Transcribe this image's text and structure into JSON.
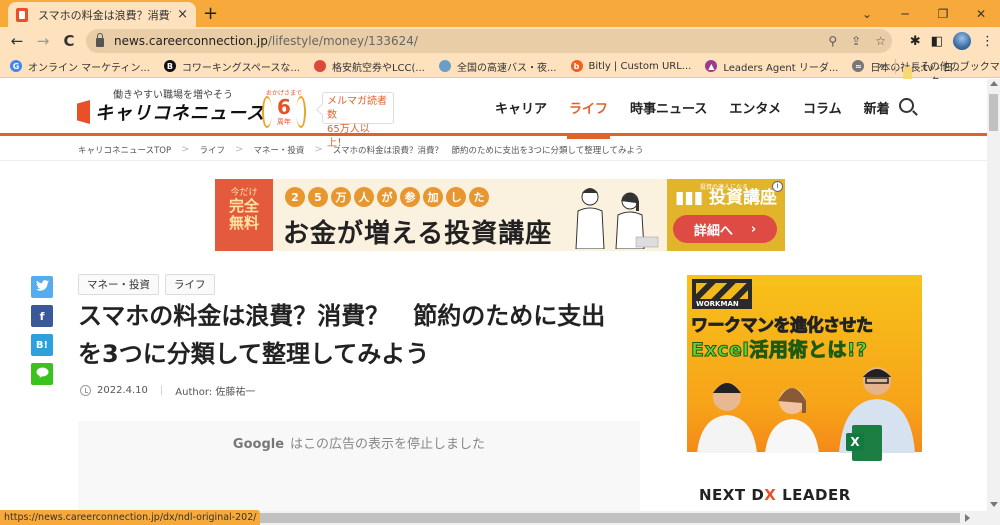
{
  "browser": {
    "tab_title": "スマホの料金は浪費？消費？ 節約",
    "tab_close": "×",
    "new_tab": "+",
    "window_controls": {
      "tab_search": "⌄",
      "minimize": "─",
      "restore": "❐",
      "close": "✕"
    },
    "nav": {
      "back": "←",
      "forward": "→",
      "reload": "C"
    },
    "url_host": "news.careerconnection.jp",
    "url_path": "/lifestyle/money/133624/",
    "omnibox_icons": [
      "search-icon",
      "share-icon",
      "star-icon"
    ],
    "toolbar_icons": [
      "extensions-icon",
      "side-panel-icon",
      "profile-avatar",
      "menu-icon"
    ],
    "bookmarks": [
      {
        "label": "オンライン マーケティン...",
        "icon": "google-icon",
        "icon_text": "G",
        "color": "#4285f4"
      },
      {
        "label": "コワーキングスペースな...",
        "icon": "b-icon",
        "icon_text": "B",
        "color": "#111111"
      },
      {
        "label": "格安航空券やLCC(...",
        "icon": "mascot-icon",
        "icon_text": "",
        "color": "#d94a3a"
      },
      {
        "label": "全国の高速バス・夜...",
        "icon": "globe-icon",
        "icon_text": "",
        "color": "#6a9ec8"
      },
      {
        "label": "Bitly | Custom URL...",
        "icon": "bitly-icon",
        "icon_text": "b",
        "color": "#ee6123"
      },
      {
        "label": "Leaders Agent リーダ...",
        "icon": "triangle-icon",
        "icon_text": "▲",
        "color": "#9b3a8e"
      },
      {
        "label": "日本の社長.tv - 日...",
        "icon": "tv-icon",
        "icon_text": "≈",
        "color": "#777777"
      }
    ],
    "bookmarks_more": "»",
    "other_bookmarks": "その他のブックマーク",
    "status_url": "https://news.careerconnection.jp/dx/ndl-original-202/"
  },
  "site": {
    "tagline": "働きやすい職場を増やそう",
    "logo": "キャリコネニュース",
    "anniversary": {
      "top": "おかげさまで",
      "number": "6",
      "unit": "周年"
    },
    "mail_badge": {
      "line1": "メルマガ読者数",
      "line2": "65万人以上！"
    },
    "nav": [
      {
        "label": "キャリア",
        "active": false
      },
      {
        "label": "ライフ",
        "active": true
      },
      {
        "label": "時事ニュース",
        "active": false
      },
      {
        "label": "エンタメ",
        "active": false
      },
      {
        "label": "コラム",
        "active": false
      },
      {
        "label": "新着",
        "active": false
      }
    ],
    "accent": "#e0622b"
  },
  "breadcrumb": [
    "キャリコネニュースTOP",
    "ライフ",
    "マネー・投資",
    "スマホの料金は浪費？消費？　節約のために支出を3つに分類して整理してみよう"
  ],
  "breadcrumb_sep": ">",
  "banner": {
    "free_small": "今だけ",
    "free_big1": "完全",
    "free_big2": "無料",
    "count_chars": [
      "2",
      "5",
      "万",
      "人",
      "が",
      "参",
      "加",
      "し",
      "た"
    ],
    "headline": "お金が増える投資講座",
    "brand_small": "投資の達人になる",
    "brand": "投資講座",
    "cta": "詳細へ",
    "cta_arrow": "›",
    "adchoice": "i"
  },
  "share": [
    {
      "name": "twitter",
      "label": "🐦",
      "color": "#55acee"
    },
    {
      "name": "facebook",
      "label": "f",
      "color": "#3b5998"
    },
    {
      "name": "hatena",
      "label": "B!",
      "color": "#2ea0dc"
    },
    {
      "name": "line",
      "label": "●",
      "color": "#3ac21e"
    }
  ],
  "article": {
    "tags": [
      "マネー・投資",
      "ライフ"
    ],
    "title_line1": "スマホの料金は浪費？消費？　節約のために支出",
    "title_line2": "を3つに分類して整理してみよう",
    "date": "2022.4.10",
    "author": "Author: 佐藤祐一"
  },
  "ad_stopped": {
    "brand": "Google",
    "message": "はこの広告の表示を停止しました"
  },
  "side_ad": {
    "brand": "WORKMAN",
    "headline1": "ワークマンを進化させた",
    "headline2": "Excel活用術とは!?",
    "excel_letter": "X",
    "footer_pre": "NEXT D",
    "footer_x": "X",
    "footer_post": " LEADER"
  }
}
